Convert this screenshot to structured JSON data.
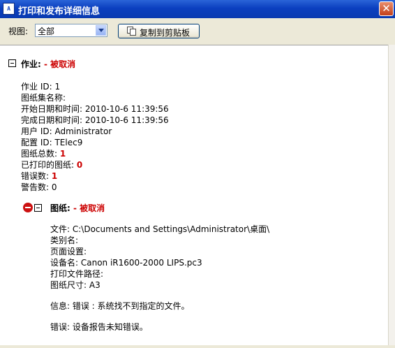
{
  "window": {
    "icon_text": "A",
    "title": "打印和发布详细信息",
    "close_glyph": "✕"
  },
  "toolbar": {
    "view_label": "视图:",
    "view_value": "全部",
    "copy_label": "复制到剪贴板"
  },
  "job": {
    "heading": "作业:",
    "status": "- 被取消",
    "lines": [
      {
        "label": "作业 ID:",
        "value": "1"
      },
      {
        "label": "图纸集名称:",
        "value": ""
      },
      {
        "label": "开始日期和时间:",
        "value": "2010-10-6 11:39:56"
      },
      {
        "label": "完成日期和时间:",
        "value": "2010-10-6 11:39:56"
      },
      {
        "label": "用户 ID:",
        "value": "Administrator"
      },
      {
        "label": "配置 ID:",
        "value": "TElec9"
      },
      {
        "label": "图纸总数:",
        "value": "1"
      },
      {
        "label": "已打印的图纸:",
        "value": "0"
      },
      {
        "label": "错误数:",
        "value": "1"
      },
      {
        "label": "警告数:",
        "value": "0"
      }
    ]
  },
  "sheet": {
    "heading": "图纸:",
    "status": "- 被取消",
    "lines": [
      {
        "label": "文件:",
        "value": "C:\\Documents and Settings\\Administrator\\桌面\\"
      },
      {
        "label": "类别名:",
        "value": ""
      },
      {
        "label": "页面设置:",
        "value": ""
      },
      {
        "label": "设备名:",
        "value": "Canon iR1600-2000 LIPS.pc3"
      },
      {
        "label": "打印文件路径:",
        "value": ""
      },
      {
        "label": "图纸尺寸:",
        "value": "A3"
      }
    ],
    "info_message": "信息: 错误 : 系统找不到指定的文件。",
    "error_message": "错误: 设备报告未知错误。"
  }
}
